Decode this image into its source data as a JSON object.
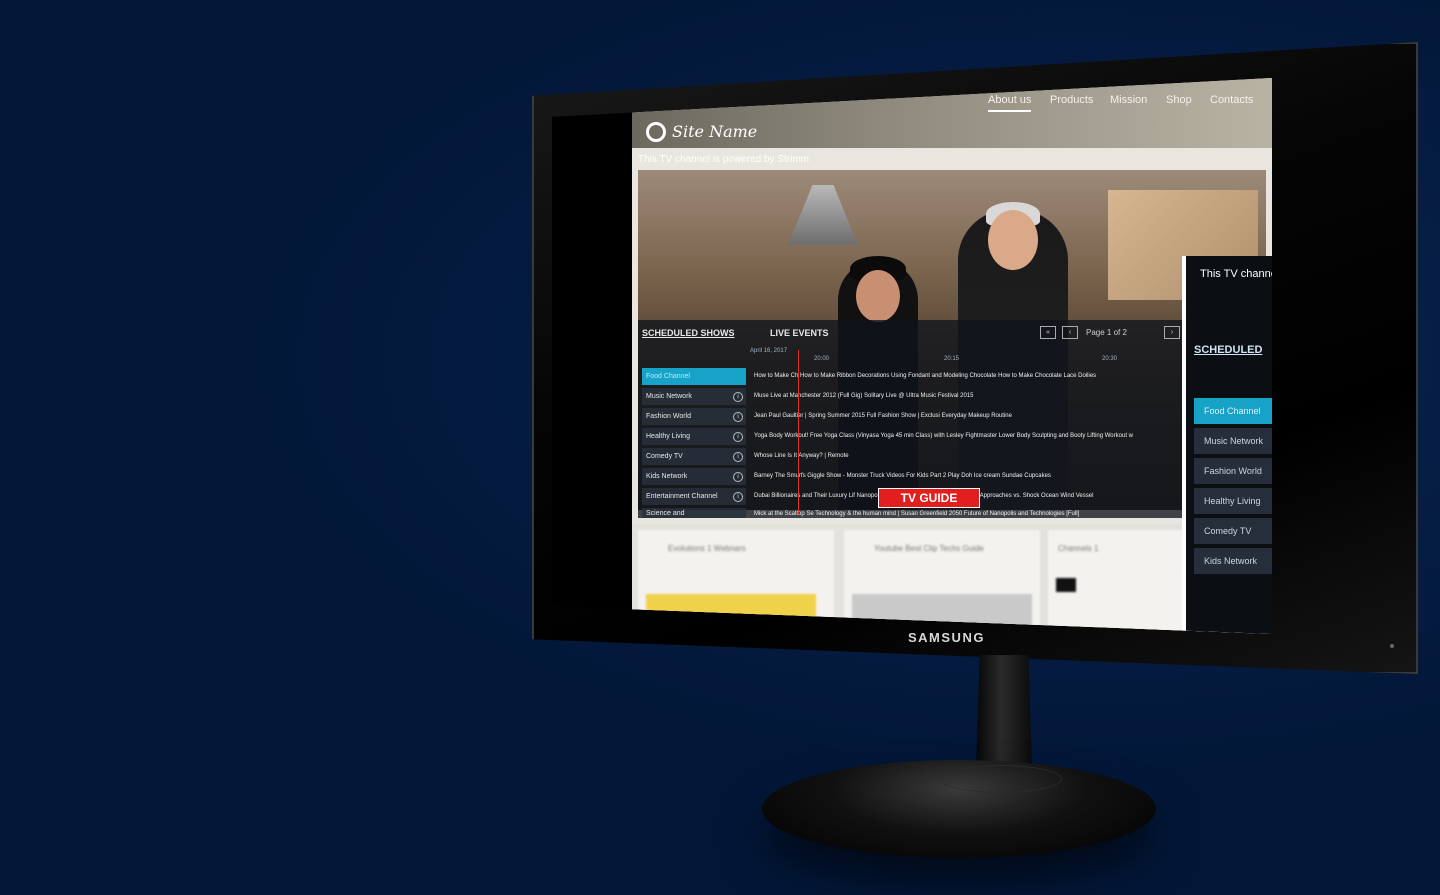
{
  "site": {
    "name": "Site Name",
    "nav": [
      "About us",
      "Products",
      "Mission",
      "Shop",
      "Contacts"
    ],
    "powered_by": "This TV channel is powered by Strimm"
  },
  "guide": {
    "tabs": [
      "SCHEDULED SHOWS",
      "LIVE EVENTS"
    ],
    "page_label": "Page 1 of 2",
    "date": "April 16, 2017",
    "ticks": [
      "20:00",
      "20:15",
      "20:30"
    ],
    "channels": [
      "Food Channel",
      "Music Network",
      "Fashion World",
      "Healthy Living",
      "Comedy TV",
      "Kids Network",
      "Entertainment Channel",
      "Science and"
    ],
    "shows": [
      "How to Make Ch   How to Make Ribbon Decorations Using Fondant and Modeling Chocolate                                  How to Make Chocolate Lace Doilies",
      "Muse Live at Manchester 2012 (Full Gig)                  Solitary Live @ Ultra Music Festival 2015",
      "Jean Paul Gaultier | Spring Summer 2015 Full Fashion Show | Exclusi   Everyday Makeup Routine",
      "Yoga Body Workout! Free Yoga Class (Vinyasa Yoga 45 min Class) with Lesley Fightmaster   Lower Body Sculpting and Booty Lifting Workout w",
      "Whose Line Is It Anyway? | Remote",
      "Barney   The Smurfs Giggle Show - Monster Truck Videos For Kids Part 2              Play Doh Ice cream Sundae Cupcakes",
      "Dubai Billionaires and Their Luxury Lif   Nanopore Showdown: Illumina Roche Fosmid Approaches vs. Shock   Ocean Wind Vessel",
      "Mick at the Scaltop Se   Technology & the human mind | Susan Greenfield   2050 Future of Nanopolis and Technologies [Full]"
    ],
    "tv_guide_label": "TV GUIDE"
  },
  "panel2": {
    "title": "This TV channe",
    "scheduled": "SCHEDULED",
    "channels": [
      "Food Channel",
      "Music Network",
      "Fashion World",
      "Healthy Living",
      "Comedy TV",
      "Kids Network"
    ]
  },
  "cards": [
    "Evolutions 1 Webnars",
    "Youtube Best Clip Techs Guide",
    "Channels 1"
  ],
  "monitor": {
    "brand": "SAMSUNG"
  },
  "colors": {
    "background": "#021738",
    "accent": "#16a3c7",
    "tv_guide": "#e21f1f",
    "now_line": "#e2312a"
  },
  "icons": [
    "site-logo-icon",
    "info-icon",
    "double-chevron-left-icon",
    "chevron-left-icon",
    "chevron-right-icon",
    "double-chevron-right-icon"
  ]
}
